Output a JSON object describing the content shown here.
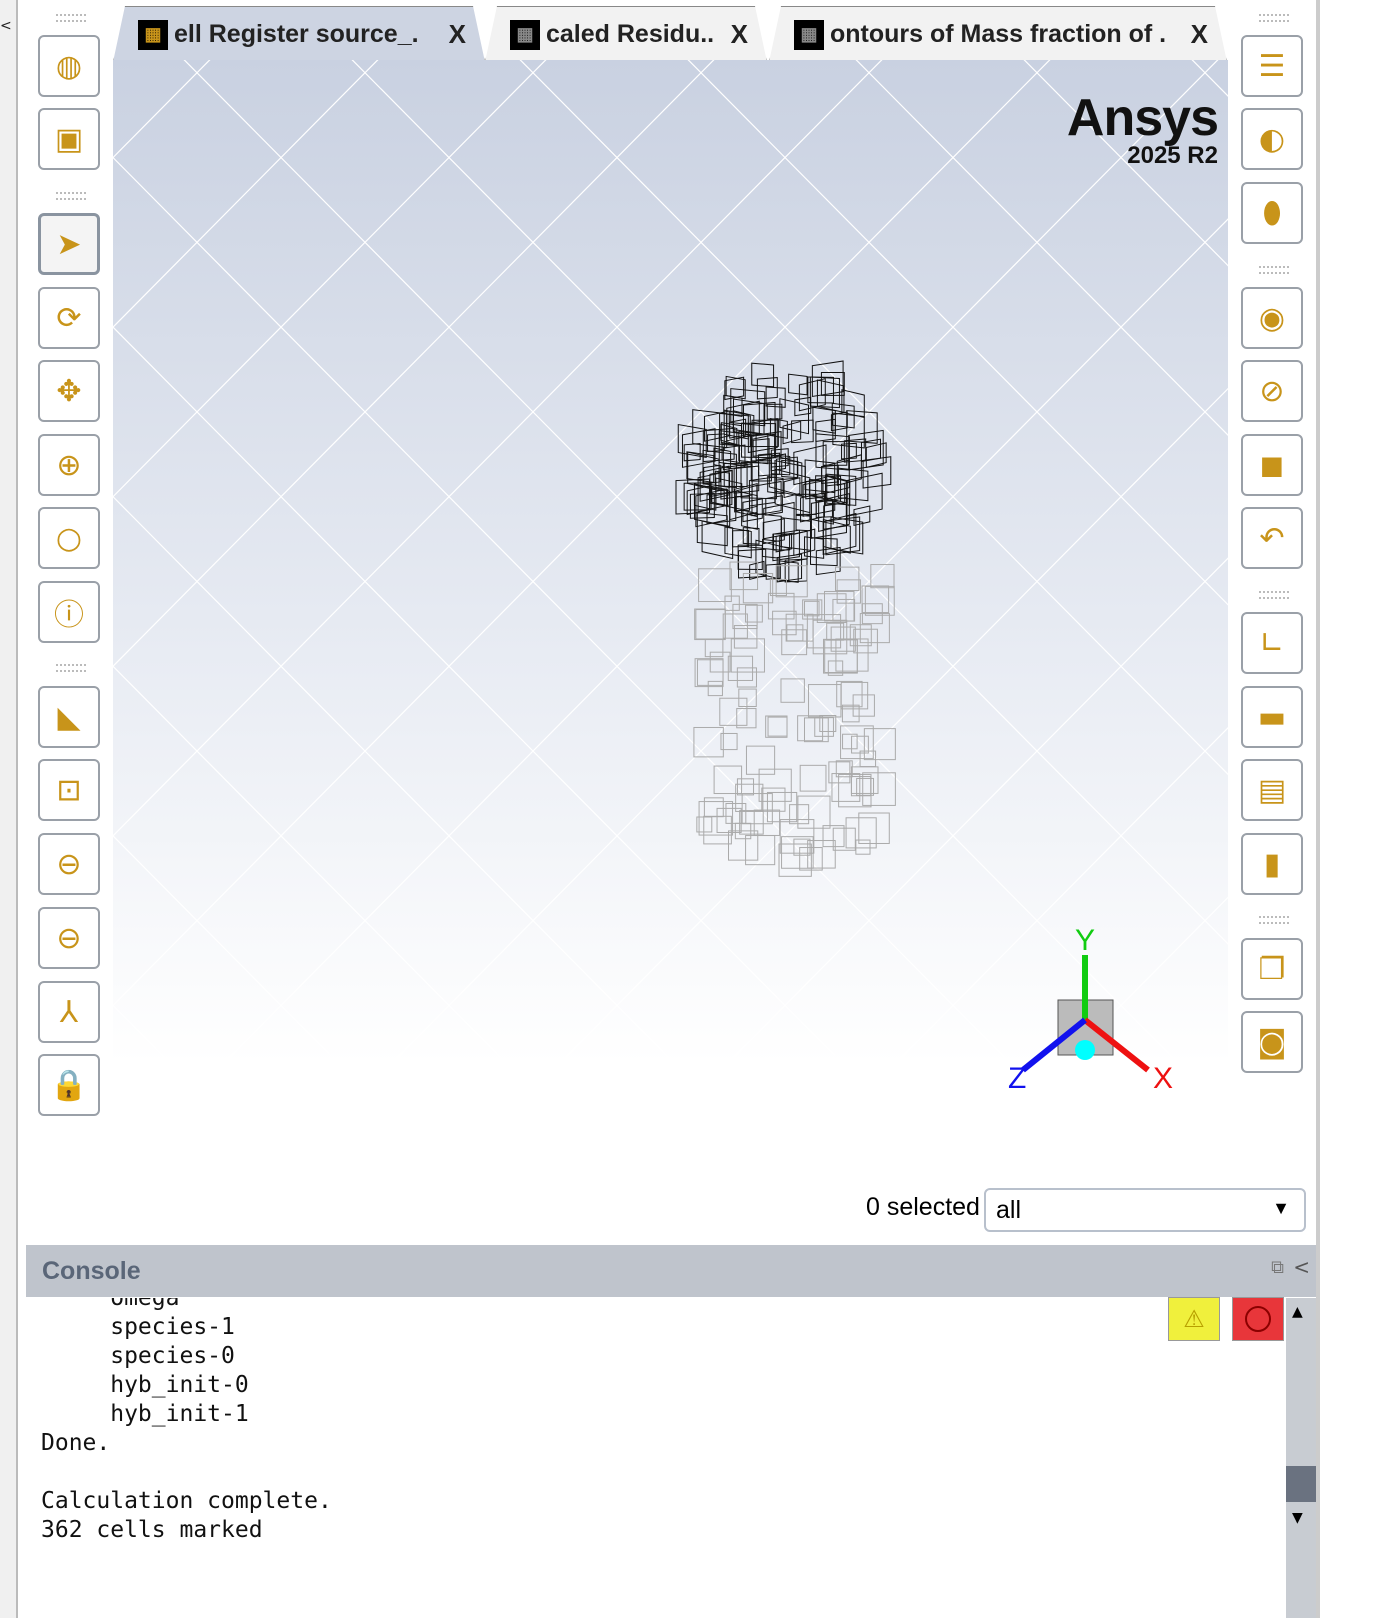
{
  "tabs": [
    {
      "label": "ell Register source_.",
      "close": "X",
      "active": true
    },
    {
      "label": "caled Residu..",
      "close": "X",
      "active": false
    },
    {
      "label": "ontours of Mass fraction of .",
      "close": "X",
      "active": false
    }
  ],
  "logo": {
    "brand": "Ansys",
    "version": "2025 R2"
  },
  "left_toolbar": [
    "mesh-display",
    "bounds",
    "select",
    "rotate",
    "pan",
    "zoom",
    "zoom-to-fit",
    "probe",
    "display-mesh",
    "zoom-box",
    "zoom-previous",
    "zoom-next",
    "axes",
    "lock-view"
  ],
  "right_toolbar": [
    "surfaces",
    "clip",
    "transparency",
    "show",
    "hide",
    "draw-box",
    "undo-view",
    "axes-display",
    "colormap",
    "annotate",
    "legend",
    "copy",
    "screenshot"
  ],
  "selection": {
    "count_label": "0 selected",
    "filter_value": "all"
  },
  "console": {
    "title": "Console",
    "lines": [
      "     omega",
      "     species-1",
      "     species-0",
      "     hyb_init-0",
      "     hyb_init-1",
      "Done.",
      "",
      "Calculation complete.",
      "362 cells marked"
    ]
  },
  "colors": {
    "accent": "#c8941a",
    "viewport_top": "#c9d1e1",
    "console_header": "#bfc4cc"
  }
}
